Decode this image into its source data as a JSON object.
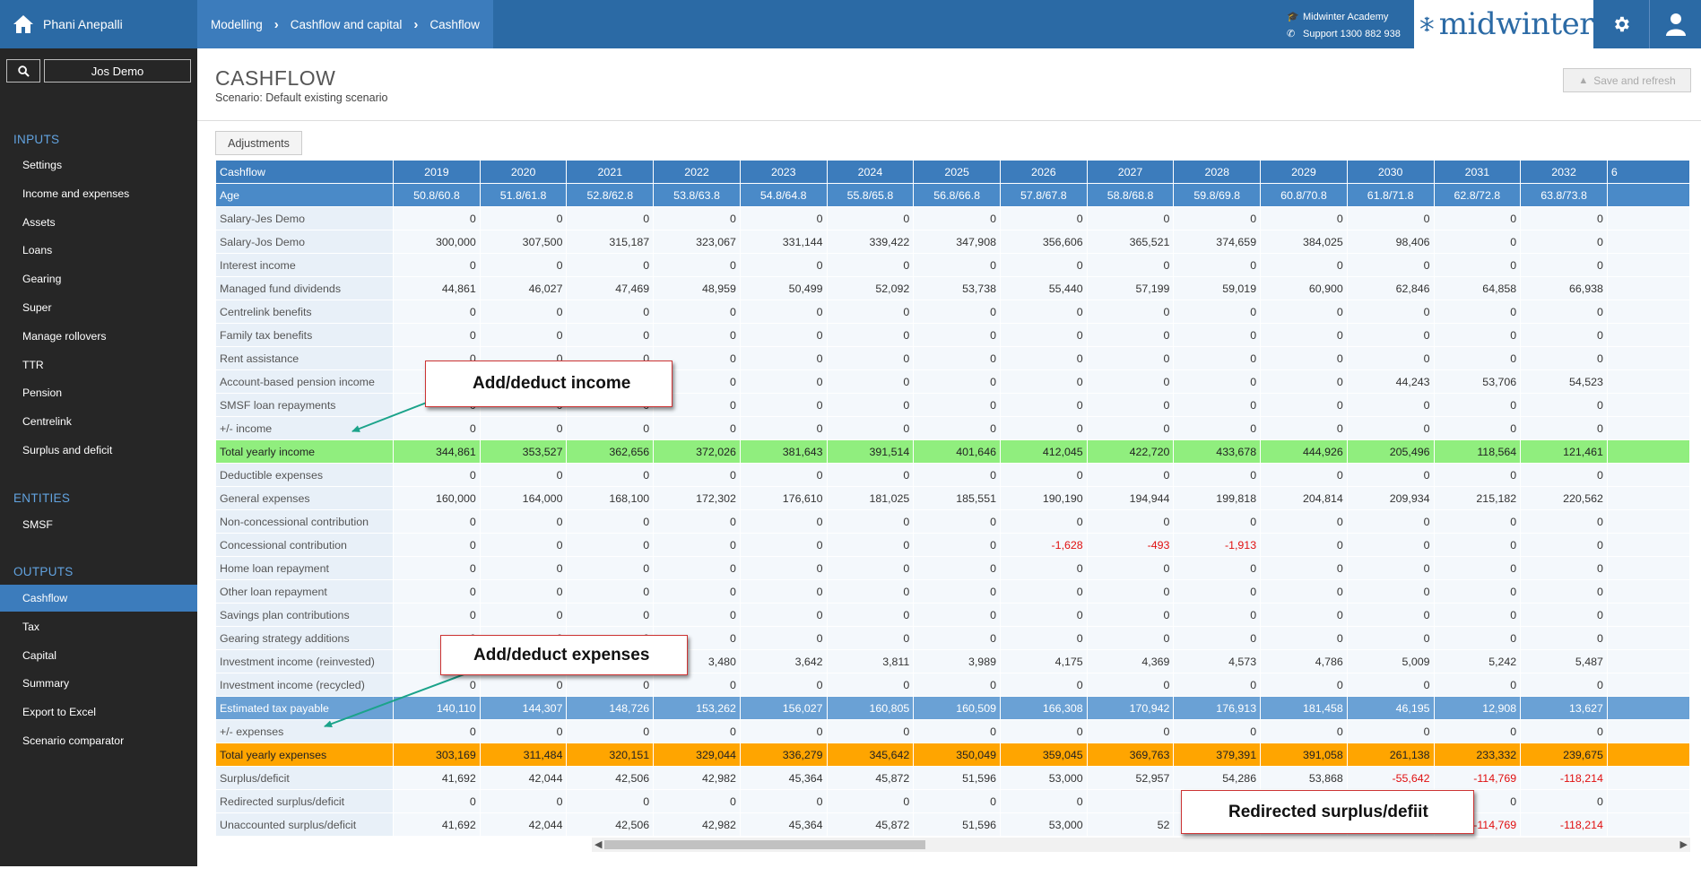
{
  "header": {
    "user_name": "Phani Anepalli",
    "breadcrumbs": [
      "Modelling",
      "Cashflow and capital",
      "Cashflow"
    ],
    "academy_link": "Midwinter Academy",
    "support_link": "Support 1300 882 938",
    "logo_text": "midwinter"
  },
  "sidebar": {
    "client_name": "Jos Demo",
    "sections": [
      {
        "title": "INPUTS",
        "items": [
          "Settings",
          "Income and expenses",
          "Assets",
          "Loans",
          "Gearing",
          "Super",
          "Manage rollovers",
          "TTR",
          "Pension",
          "Centrelink",
          "Surplus and deficit"
        ]
      },
      {
        "title": "ENTITIES",
        "items": [
          "SMSF"
        ]
      },
      {
        "title": "OUTPUTS",
        "items": [
          "Cashflow",
          "Tax",
          "Capital",
          "Summary",
          "Export to Excel",
          "Scenario comparator"
        ]
      }
    ],
    "active_item": "Cashflow"
  },
  "page": {
    "title": "CASHFLOW",
    "subtitle": "Scenario: Default existing scenario",
    "save_button": "Save and refresh",
    "adjustments_button": "Adjustments"
  },
  "table": {
    "header_label": "Cashflow",
    "years": [
      "2019",
      "2020",
      "2021",
      "2022",
      "2023",
      "2024",
      "2025",
      "2026",
      "2027",
      "2028",
      "2029",
      "2030",
      "2031",
      "2032"
    ],
    "partial_next": "6",
    "rows": [
      {
        "label": "Age",
        "style": "age",
        "values": [
          "50.8/60.8",
          "51.8/61.8",
          "52.8/62.8",
          "53.8/63.8",
          "54.8/64.8",
          "55.8/65.8",
          "56.8/66.8",
          "57.8/67.8",
          "58.8/68.8",
          "59.8/69.8",
          "60.8/70.8",
          "61.8/71.8",
          "62.8/72.8",
          "63.8/73.8"
        ]
      },
      {
        "label": "Salary-Jes Demo",
        "style": "norm",
        "values": [
          "0",
          "0",
          "0",
          "0",
          "0",
          "0",
          "0",
          "0",
          "0",
          "0",
          "0",
          "0",
          "0",
          "0"
        ]
      },
      {
        "label": "Salary-Jos Demo",
        "style": "norm",
        "values": [
          "300,000",
          "307,500",
          "315,187",
          "323,067",
          "331,144",
          "339,422",
          "347,908",
          "356,606",
          "365,521",
          "374,659",
          "384,025",
          "98,406",
          "0",
          "0"
        ]
      },
      {
        "label": "Interest income",
        "style": "norm",
        "values": [
          "0",
          "0",
          "0",
          "0",
          "0",
          "0",
          "0",
          "0",
          "0",
          "0",
          "0",
          "0",
          "0",
          "0"
        ]
      },
      {
        "label": "Managed fund dividends",
        "style": "norm",
        "values": [
          "44,861",
          "46,027",
          "47,469",
          "48,959",
          "50,499",
          "52,092",
          "53,738",
          "55,440",
          "57,199",
          "59,019",
          "60,900",
          "62,846",
          "64,858",
          "66,938"
        ]
      },
      {
        "label": "Centrelink benefits",
        "style": "norm",
        "values": [
          "0",
          "0",
          "0",
          "0",
          "0",
          "0",
          "0",
          "0",
          "0",
          "0",
          "0",
          "0",
          "0",
          "0"
        ]
      },
      {
        "label": "Family tax benefits",
        "style": "norm",
        "values": [
          "0",
          "0",
          "0",
          "0",
          "0",
          "0",
          "0",
          "0",
          "0",
          "0",
          "0",
          "0",
          "0",
          "0"
        ]
      },
      {
        "label": "Rent assistance",
        "style": "norm",
        "values": [
          "0",
          "0",
          "0",
          "0",
          "0",
          "0",
          "0",
          "0",
          "0",
          "0",
          "0",
          "0",
          "0",
          "0"
        ]
      },
      {
        "label": "Account-based pension income",
        "style": "norm",
        "values": [
          "0",
          "0",
          "0",
          "0",
          "0",
          "0",
          "0",
          "0",
          "0",
          "0",
          "0",
          "44,243",
          "53,706",
          "54,523"
        ]
      },
      {
        "label": "SMSF loan repayments",
        "style": "norm",
        "values": [
          "0",
          "0",
          "0",
          "0",
          "0",
          "0",
          "0",
          "0",
          "0",
          "0",
          "0",
          "0",
          "0",
          "0"
        ]
      },
      {
        "label": "+/- income",
        "style": "norm",
        "values": [
          "0",
          "0",
          "0",
          "0",
          "0",
          "0",
          "0",
          "0",
          "0",
          "0",
          "0",
          "0",
          "0",
          "0"
        ]
      },
      {
        "label": "Total yearly income",
        "style": "ginc",
        "values": [
          "344,861",
          "353,527",
          "362,656",
          "372,026",
          "381,643",
          "391,514",
          "401,646",
          "412,045",
          "422,720",
          "433,678",
          "444,926",
          "205,496",
          "118,564",
          "121,461"
        ]
      },
      {
        "label": "Deductible expenses",
        "style": "norm",
        "values": [
          "0",
          "0",
          "0",
          "0",
          "0",
          "0",
          "0",
          "0",
          "0",
          "0",
          "0",
          "0",
          "0",
          "0"
        ]
      },
      {
        "label": "General expenses",
        "style": "norm",
        "values": [
          "160,000",
          "164,000",
          "168,100",
          "172,302",
          "176,610",
          "181,025",
          "185,551",
          "190,190",
          "194,944",
          "199,818",
          "204,814",
          "209,934",
          "215,182",
          "220,562"
        ]
      },
      {
        "label": "Non-concessional contribution",
        "style": "norm",
        "values": [
          "0",
          "0",
          "0",
          "0",
          "0",
          "0",
          "0",
          "0",
          "0",
          "0",
          "0",
          "0",
          "0",
          "0"
        ]
      },
      {
        "label": "Concessional contribution",
        "style": "norm",
        "values": [
          "0",
          "0",
          "0",
          "0",
          "0",
          "0",
          "0",
          "-1,628",
          "-493",
          "-1,913",
          "0",
          "0",
          "0",
          "0"
        ]
      },
      {
        "label": "Home loan repayment",
        "style": "norm",
        "values": [
          "0",
          "0",
          "0",
          "0",
          "0",
          "0",
          "0",
          "0",
          "0",
          "0",
          "0",
          "0",
          "0",
          "0"
        ]
      },
      {
        "label": "Other loan repayment",
        "style": "norm",
        "values": [
          "0",
          "0",
          "0",
          "0",
          "0",
          "0",
          "0",
          "0",
          "0",
          "0",
          "0",
          "0",
          "0",
          "0"
        ]
      },
      {
        "label": "Savings plan contributions",
        "style": "norm",
        "values": [
          "0",
          "0",
          "0",
          "0",
          "0",
          "0",
          "0",
          "0",
          "0",
          "0",
          "0",
          "0",
          "0",
          "0"
        ]
      },
      {
        "label": "Gearing strategy additions",
        "style": "norm",
        "values": [
          "0",
          "0",
          "0",
          "0",
          "0",
          "0",
          "0",
          "0",
          "0",
          "0",
          "0",
          "0",
          "0",
          "0"
        ]
      },
      {
        "label": "Investment income (reinvested)",
        "style": "norm",
        "values": [
          "",
          "",
          "",
          "3,480",
          "3,642",
          "3,811",
          "3,989",
          "4,175",
          "4,369",
          "4,573",
          "4,786",
          "5,009",
          "5,242",
          "5,487"
        ]
      },
      {
        "label": "Investment income (recycled)",
        "style": "norm",
        "values": [
          "0",
          "0",
          "0",
          "0",
          "0",
          "0",
          "0",
          "0",
          "0",
          "0",
          "0",
          "0",
          "0",
          "0"
        ]
      },
      {
        "label": "Estimated tax payable",
        "style": "tax",
        "values": [
          "140,110",
          "144,307",
          "148,726",
          "153,262",
          "156,027",
          "160,805",
          "160,509",
          "166,308",
          "170,942",
          "176,913",
          "181,458",
          "46,195",
          "12,908",
          "13,627"
        ]
      },
      {
        "label": "+/- expenses",
        "style": "norm",
        "values": [
          "0",
          "0",
          "0",
          "0",
          "0",
          "0",
          "0",
          "0",
          "0",
          "0",
          "0",
          "0",
          "0",
          "0"
        ]
      },
      {
        "label": "Total yearly expenses",
        "style": "oexp",
        "values": [
          "303,169",
          "311,484",
          "320,151",
          "329,044",
          "336,279",
          "345,642",
          "350,049",
          "359,045",
          "369,763",
          "379,391",
          "391,058",
          "261,138",
          "233,332",
          "239,675"
        ]
      },
      {
        "label": "Surplus/deficit",
        "style": "norm",
        "values": [
          "41,692",
          "42,044",
          "42,506",
          "42,982",
          "45,364",
          "45,872",
          "51,596",
          "53,000",
          "52,957",
          "54,286",
          "53,868",
          "-55,642",
          "-114,769",
          "-118,214"
        ]
      },
      {
        "label": "Redirected surplus/deficit",
        "style": "norm",
        "values": [
          "0",
          "0",
          "0",
          "0",
          "0",
          "0",
          "0",
          "0",
          "",
          "",
          "",
          "",
          "0",
          "0"
        ]
      },
      {
        "label": "Unaccounted surplus/deficit",
        "style": "norm",
        "values": [
          "41,692",
          "42,044",
          "42,506",
          "42,982",
          "45,364",
          "45,872",
          "51,596",
          "53,000",
          "52",
          "",
          "",
          "",
          "-114,769",
          "-118,214"
        ]
      }
    ]
  },
  "annotations": {
    "income": "Add/deduct income",
    "expenses": "Add/deduct expenses",
    "redirected": "Redirected surplus/defiit"
  },
  "colors": {
    "header_blue": "#2b6aa5",
    "total_income_green": "#90ee7e",
    "total_expenses_orange": "#ffa500",
    "tax_blue": "#6aa1d5",
    "negative_red": "#e01010"
  }
}
